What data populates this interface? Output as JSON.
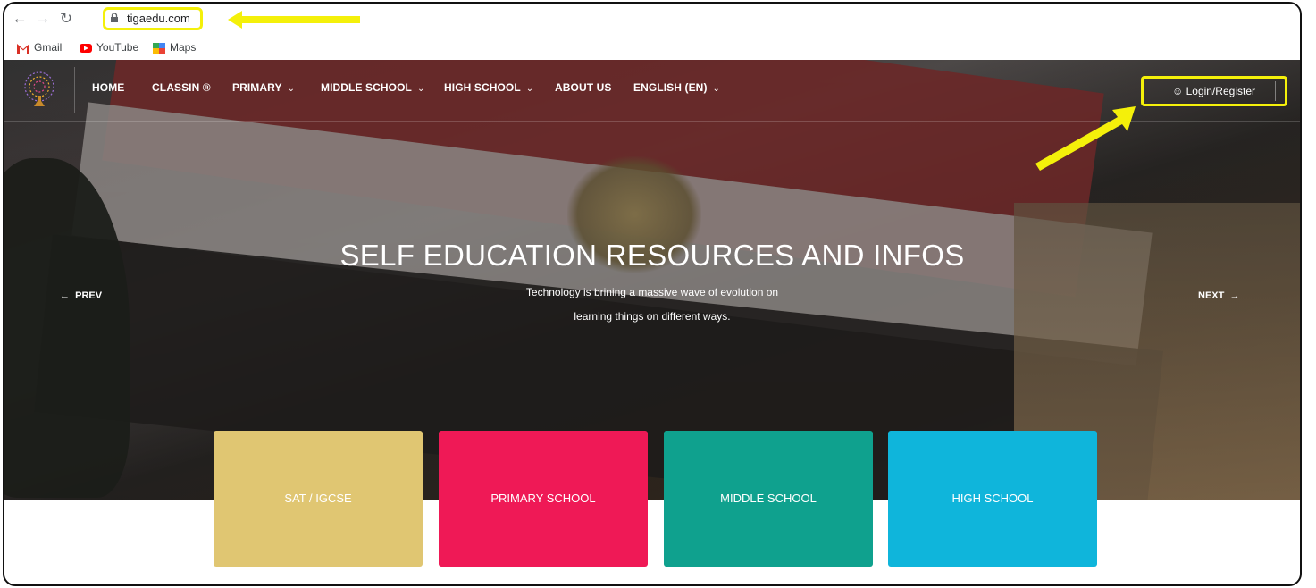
{
  "browser": {
    "url": "tigaedu.com",
    "bookmarks": [
      {
        "label": "Gmail"
      },
      {
        "label": "YouTube"
      },
      {
        "label": "Maps"
      }
    ],
    "highlight_color": "#f4f00a"
  },
  "site": {
    "nav": {
      "items": [
        {
          "label": "HOME",
          "has_dropdown": false
        },
        {
          "label": "CLASSIN ®",
          "has_dropdown": false
        },
        {
          "label": "PRIMARY",
          "has_dropdown": true
        },
        {
          "label": "MIDDLE SCHOOL",
          "has_dropdown": true
        },
        {
          "label": "HIGH SCHOOL",
          "has_dropdown": true
        },
        {
          "label": "ABOUT US",
          "has_dropdown": false
        },
        {
          "label": "ENGLISH (EN)",
          "has_dropdown": true
        }
      ],
      "login_label": "Login/Register"
    },
    "hero": {
      "title": "SELF EDUCATION RESOURCES AND INFOS",
      "subtitle_line1": "Technology is brining a massive wave of evolution on",
      "subtitle_line2": "learning things on different ways.",
      "prev_label": "PREV",
      "next_label": "NEXT"
    },
    "cards": [
      {
        "label": "SAT / IGCSE",
        "color": "#e0c672"
      },
      {
        "label": "PRIMARY SCHOOL",
        "color": "#ef1956"
      },
      {
        "label": "MIDDLE SCHOOL",
        "color": "#0fa18e"
      },
      {
        "label": "HIGH SCHOOL",
        "color": "#0fb5db"
      }
    ]
  }
}
